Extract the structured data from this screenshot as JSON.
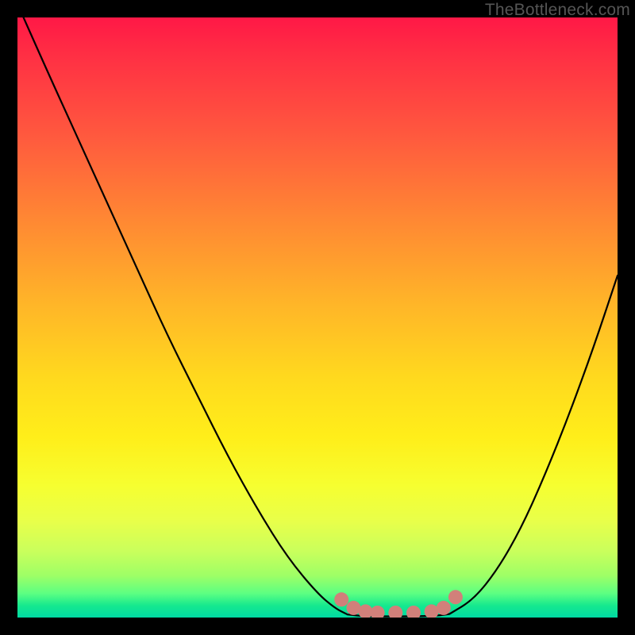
{
  "watermark": "TheBottleneck.com",
  "chart_data": {
    "type": "line",
    "title": "",
    "xlabel": "",
    "ylabel": "",
    "xlim": [
      0,
      100
    ],
    "ylim": [
      0,
      100
    ],
    "grid": false,
    "legend": false,
    "series": [
      {
        "name": "left-curve",
        "x": [
          1,
          5,
          10,
          15,
          20,
          25,
          30,
          35,
          40,
          45,
          50,
          53,
          55
        ],
        "y": [
          100,
          91,
          80,
          69,
          58,
          47,
          37,
          27,
          18,
          10,
          4,
          1.5,
          0.5
        ]
      },
      {
        "name": "valley-floor",
        "x": [
          55,
          58,
          62,
          66,
          70,
          72
        ],
        "y": [
          0.5,
          0.2,
          0.2,
          0.2,
          0.3,
          0.6
        ]
      },
      {
        "name": "right-curve",
        "x": [
          72,
          76,
          80,
          84,
          88,
          92,
          96,
          100
        ],
        "y": [
          0.6,
          3,
          8,
          15,
          24,
          34,
          45,
          57
        ]
      }
    ],
    "markers": [
      {
        "name": "floor-dot-1",
        "x": 54,
        "y": 3.0
      },
      {
        "name": "floor-dot-2",
        "x": 56,
        "y": 1.6
      },
      {
        "name": "floor-dot-3",
        "x": 58,
        "y": 1.0
      },
      {
        "name": "floor-dot-4",
        "x": 60,
        "y": 0.8
      },
      {
        "name": "floor-dot-5",
        "x": 63,
        "y": 0.8
      },
      {
        "name": "floor-dot-6",
        "x": 66,
        "y": 0.8
      },
      {
        "name": "floor-dot-7",
        "x": 69,
        "y": 1.0
      },
      {
        "name": "floor-dot-8",
        "x": 71,
        "y": 1.6
      },
      {
        "name": "floor-dot-9",
        "x": 73,
        "y": 3.4
      }
    ],
    "colors": {
      "curve": "#000000",
      "marker": "#d1807a",
      "frame": "#000000"
    }
  }
}
